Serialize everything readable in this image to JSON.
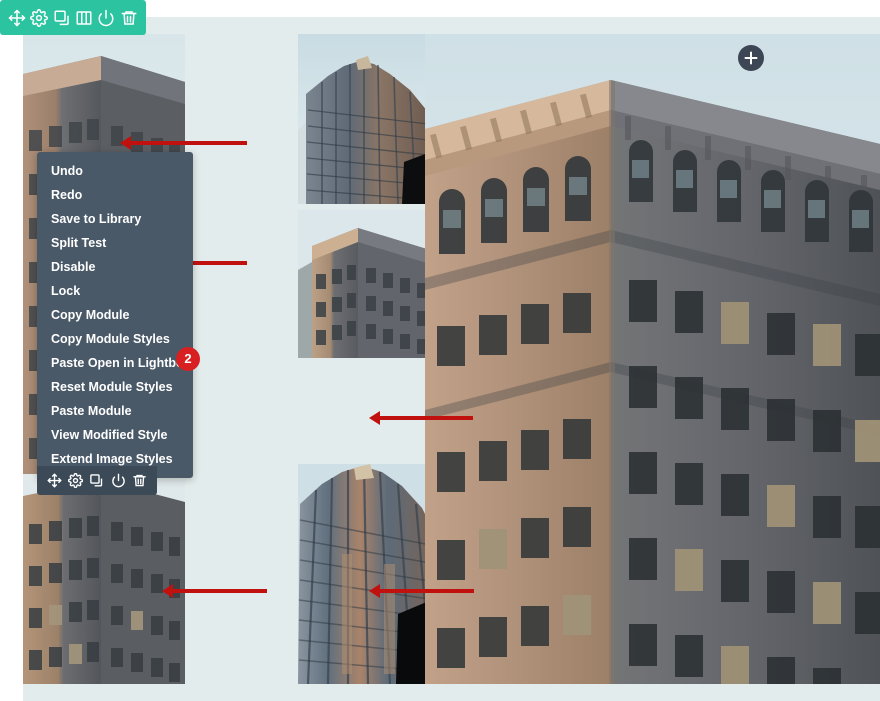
{
  "app": {
    "background_color": "#e3ecec",
    "accent_green": "#2cc4a0",
    "menu_bg": "#4a5968",
    "badge_color": "#d81f21",
    "arrow_color": "#c0110f"
  },
  "module_toolbar": {
    "name": "module-action-toolbar",
    "icons": [
      {
        "name": "move-icon",
        "label": "Move"
      },
      {
        "name": "gear-icon",
        "label": "Settings"
      },
      {
        "name": "duplicate-icon",
        "label": "Duplicate"
      },
      {
        "name": "columns-icon",
        "label": "Columns"
      },
      {
        "name": "power-icon",
        "label": "Disable"
      },
      {
        "name": "trash-icon",
        "label": "Delete"
      }
    ]
  },
  "row_toolbar": {
    "name": "row-action-toolbar",
    "icons": [
      {
        "name": "move-icon",
        "label": "Move"
      },
      {
        "name": "gear-icon",
        "label": "Settings"
      },
      {
        "name": "duplicate-icon",
        "label": "Duplicate"
      },
      {
        "name": "power-icon",
        "label": "Disable"
      },
      {
        "name": "trash-icon",
        "label": "Delete"
      }
    ]
  },
  "context_menu": {
    "items": [
      {
        "label": "Undo"
      },
      {
        "label": "Redo"
      },
      {
        "label": "Save to Library"
      },
      {
        "label": "Split Test"
      },
      {
        "label": "Disable"
      },
      {
        "label": "Lock"
      },
      {
        "label": "Copy Module"
      },
      {
        "label": "Copy Module Styles"
      },
      {
        "label": "Paste Open in Lightbox"
      },
      {
        "label": "Reset Module Styles"
      },
      {
        "label": "Paste Module"
      },
      {
        "label": "View Modified Style"
      },
      {
        "label": "Extend Image Styles"
      }
    ]
  },
  "badge": {
    "value": "2"
  },
  "add_button": {
    "label": "+"
  },
  "gallery": {
    "columns": [
      {
        "name": "column-left",
        "photos": [
          {
            "name": "photo-classical-building-tall",
            "subject": "classical-stone-building"
          },
          {
            "name": "photo-classical-building-lower",
            "subject": "classical-stone-building"
          }
        ]
      },
      {
        "name": "column-middle",
        "photos": [
          {
            "name": "photo-modern-tower-top",
            "subject": "modern-glass-tower"
          },
          {
            "name": "photo-stone-facade-mid",
            "subject": "stone-facade"
          },
          {
            "name": "photo-modern-tower-bottom",
            "subject": "modern-glass-tower"
          }
        ]
      },
      {
        "name": "column-right",
        "photos": [
          {
            "name": "photo-cornice-facade-large",
            "subject": "ornate-cornice-facade"
          }
        ]
      }
    ]
  },
  "annotations": {
    "arrows": [
      {
        "name": "arrow-middle-top"
      },
      {
        "name": "arrow-middle-mid"
      },
      {
        "name": "arrow-right-large"
      },
      {
        "name": "arrow-left-bottom"
      },
      {
        "name": "arrow-middle-bottom"
      }
    ]
  }
}
